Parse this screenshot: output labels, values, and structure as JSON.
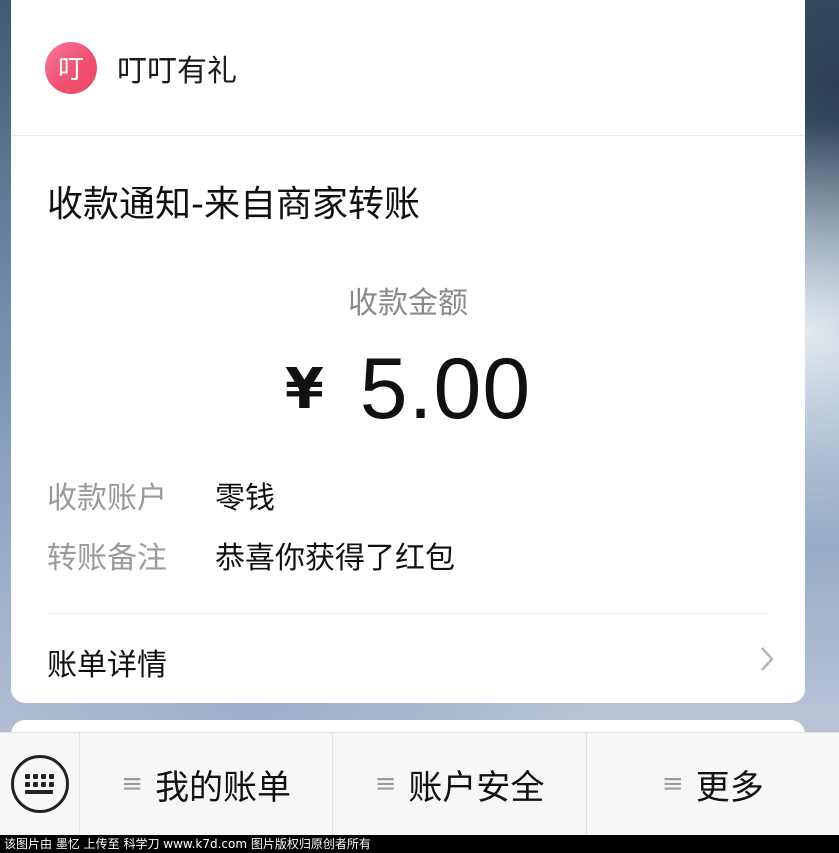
{
  "app": {
    "logo_glyph": "叮",
    "name": "叮叮有礼"
  },
  "notice": {
    "title": "收款通知-来自商家转账",
    "amount_label": "收款金额",
    "currency": "¥",
    "amount": "5.00",
    "rows": [
      {
        "key": "收款账户",
        "value": "零钱"
      },
      {
        "key": "转账备注",
        "value": "恭喜你获得了红包"
      }
    ],
    "detail_label": "账单详情"
  },
  "menu": {
    "items": [
      {
        "label": "我的账单"
      },
      {
        "label": "账户安全"
      },
      {
        "label": "更多"
      }
    ]
  },
  "footer": {
    "text": "该图片由 墨忆 上传至 科学刀 www.k7d.com 图片版权归原创者所有"
  },
  "colors": {
    "logo": "#f0506e",
    "muted": "#8a8a8a"
  },
  "icons": [
    "keyboard-icon",
    "chevron-right-icon",
    "menu-lines-icon"
  ]
}
